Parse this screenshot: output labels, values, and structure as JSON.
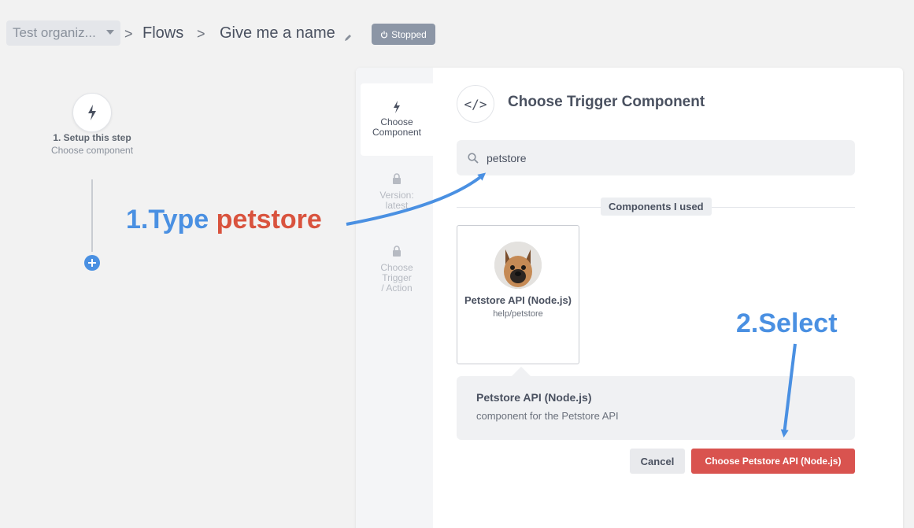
{
  "header": {
    "org": "Test organiz...",
    "crumb_sep": ">",
    "flows": "Flows",
    "flow_name": "Give me a name",
    "status": "Stopped"
  },
  "flow": {
    "step_title": "1. Setup this step",
    "step_subtitle": "Choose component"
  },
  "sidebar": {
    "tabs": [
      {
        "label": "Choose Component",
        "state": "active",
        "icon": "lightning-icon"
      },
      {
        "label": "Version: latest",
        "state": "locked",
        "icon": "lock-icon"
      },
      {
        "label": "Choose Trigger / Action",
        "state": "locked",
        "icon": "lock-icon"
      }
    ]
  },
  "panel": {
    "title": "Choose Trigger Component",
    "search_value": "petstore",
    "section_label": "Components I used",
    "component": {
      "name": "Petstore API (Node.js)",
      "path": "help/petstore"
    },
    "detail": {
      "name": "Petstore API (Node.js)",
      "description": "component for the Petstore API"
    },
    "cancel_label": "Cancel",
    "choose_label": "Choose Petstore API (Node.js)"
  },
  "annotations": {
    "step1_prefix": "1.Type",
    "step1_keyword": "petstore",
    "step2": "2.Select"
  },
  "colors": {
    "accent": "#4a90e2",
    "danger": "#d9534f",
    "badge": "#8c96a6"
  }
}
